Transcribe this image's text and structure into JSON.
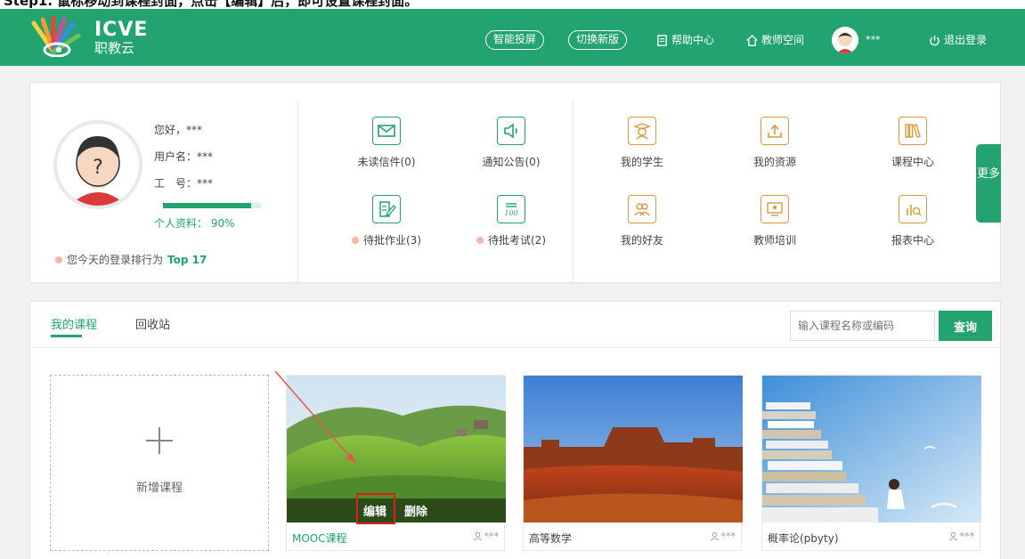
{
  "caption": "Step1. 鼠标移动到课程封面，点击【编辑】后，即可设置课程封面。",
  "header": {
    "logo_name": "ICVE",
    "logo_sub": "职教云",
    "pill_1": "智能投屏",
    "pill_2": "切换新版",
    "help": "帮助中心",
    "teacher_space": "教师空间",
    "username": "***",
    "logout": "退出登录",
    "brand_color": "#22a36f"
  },
  "profile": {
    "greeting": "您好，***",
    "username_label": "用户名：***",
    "staff_no_label": "工　号：***",
    "completeness_label": "个人资料：",
    "completeness_value": "90%",
    "completeness_fraction": 0.9,
    "rank_text": "您今天的登录排行为",
    "rank_value": "Top 17"
  },
  "quick": {
    "unread_mail": "未读信件(0)",
    "notices": "通知公告(0)",
    "my_students": "我的学生",
    "my_resources": "我的资源",
    "course_center": "课程中心",
    "pending_homework": "待批作业(3)",
    "pending_exams": "待批考试(2)",
    "my_friends": "我的好友",
    "teacher_training": "教师培训",
    "report_center": "报表中心",
    "more": "更多"
  },
  "courses": {
    "tab_mine": "我的课程",
    "tab_recycle": "回收站",
    "search_placeholder": "输入课程名称或编码",
    "search_button": "查询",
    "add_label": "新增课程",
    "edit": "编辑",
    "delete": "删除",
    "items": [
      {
        "name": "MOOC课程",
        "teacher": "***"
      },
      {
        "name": "高等数学",
        "teacher": "***"
      },
      {
        "name": "概率论(pbyty)",
        "teacher": "***"
      }
    ]
  }
}
